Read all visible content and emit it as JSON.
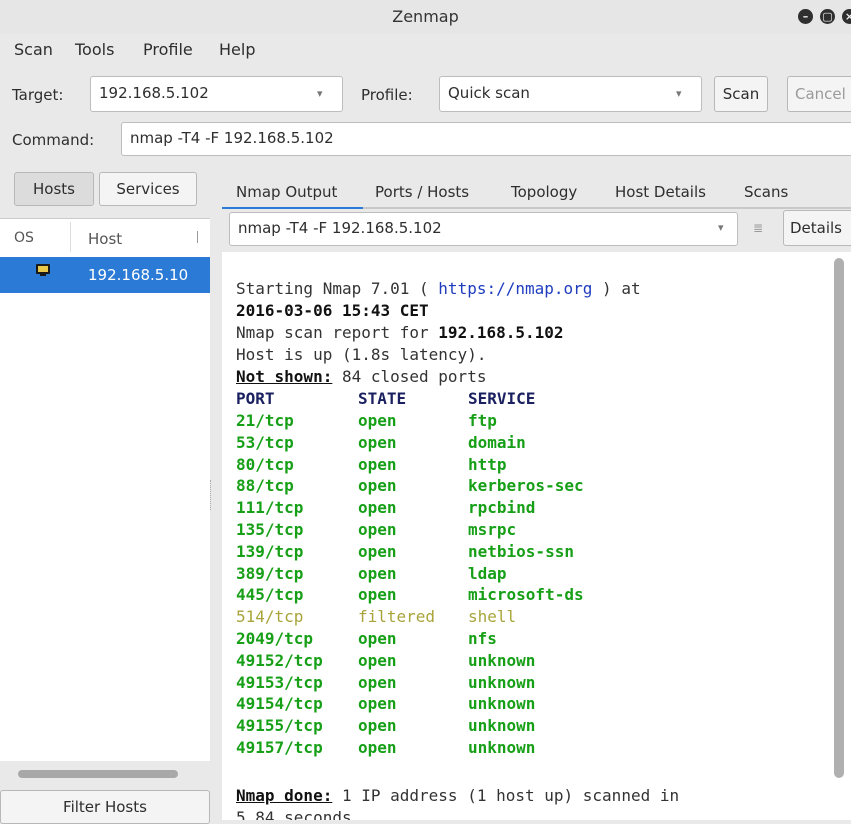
{
  "window": {
    "title": "Zenmap"
  },
  "menu": [
    "Scan",
    "Tools",
    "Profile",
    "Help"
  ],
  "toolbar": {
    "target_label": "Target:",
    "target_value": "192.168.5.102",
    "profile_label": "Profile:",
    "profile_value": "Quick scan",
    "scan_button": "Scan",
    "cancel_button": "Cancel"
  },
  "command": {
    "label": "Command:",
    "value": "nmap -T4 -F 192.168.5.102"
  },
  "left": {
    "tabs": [
      "Hosts",
      "Services"
    ],
    "col_os": "OS",
    "col_host": "Host",
    "host": "192.168.5.10",
    "filter_button": "Filter Hosts"
  },
  "right": {
    "tabs": [
      "Nmap Output",
      "Ports / Hosts",
      "Topology",
      "Host Details",
      "Scans"
    ],
    "command_select": "nmap -T4 -F 192.168.5.102",
    "details_button": "Details"
  },
  "output": {
    "start_prefix": "Starting Nmap 7.01 ( ",
    "start_link": "https://nmap.org",
    "start_suffix": " ) at",
    "timestamp": "2016-03-06 15:43 CET",
    "report_prefix": "Nmap scan report for ",
    "report_ip": "192.168.5.102",
    "host_up": "Host is up (1.8s latency).",
    "not_shown_label": "Not shown:",
    "not_shown_text": " 84 closed ports",
    "header": [
      "PORT",
      "STATE",
      "SERVICE"
    ],
    "ports": [
      [
        "21/tcp",
        "open",
        "ftp"
      ],
      [
        "53/tcp",
        "open",
        "domain"
      ],
      [
        "80/tcp",
        "open",
        "http"
      ],
      [
        "88/tcp",
        "open",
        "kerberos-sec"
      ],
      [
        "111/tcp",
        "open",
        "rpcbind"
      ],
      [
        "135/tcp",
        "open",
        "msrpc"
      ],
      [
        "139/tcp",
        "open",
        "netbios-ssn"
      ],
      [
        "389/tcp",
        "open",
        "ldap"
      ],
      [
        "445/tcp",
        "open",
        "microsoft-ds"
      ],
      [
        "514/tcp",
        "filtered",
        "shell"
      ],
      [
        "2049/tcp",
        "open",
        "nfs"
      ],
      [
        "49152/tcp",
        "open",
        "unknown"
      ],
      [
        "49153/tcp",
        "open",
        "unknown"
      ],
      [
        "49154/tcp",
        "open",
        "unknown"
      ],
      [
        "49155/tcp",
        "open",
        "unknown"
      ],
      [
        "49157/tcp",
        "open",
        "unknown"
      ]
    ],
    "done_label": "Nmap done:",
    "done_text": " 1 IP address (1 host up) scanned in",
    "done_cont": "5.84 seconds"
  },
  "icons": {
    "minimize": "minimize-icon",
    "maximize": "maximize-icon",
    "close": "close-icon",
    "host_os": "linux-os-icon"
  }
}
